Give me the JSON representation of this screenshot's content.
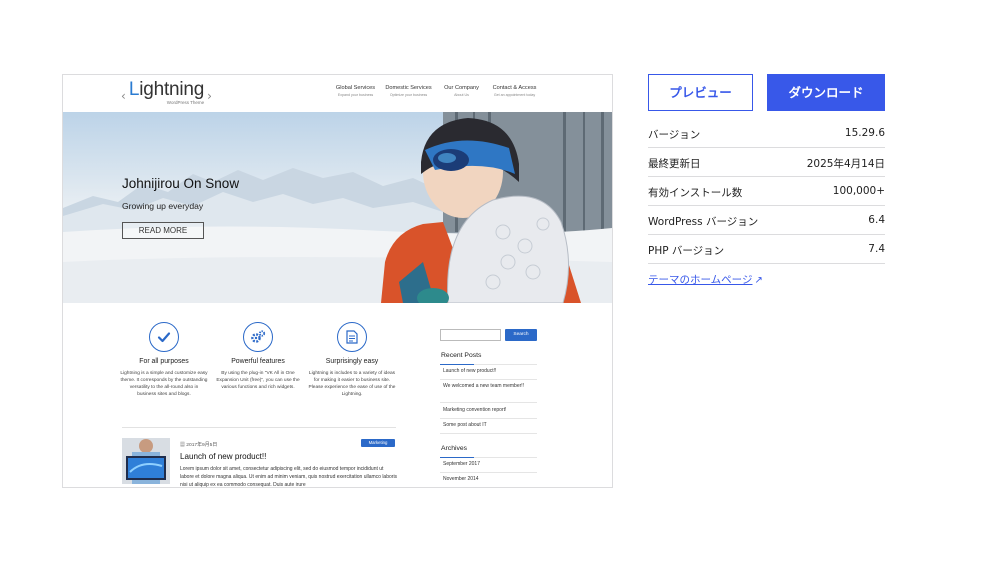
{
  "theme_preview": {
    "logo": {
      "prefix": "L",
      "text": "ightning",
      "sub": "WordPress Theme",
      "left_bracket": "‹",
      "right_bracket": "›"
    },
    "nav": [
      {
        "title": "Global Services",
        "sub": "Expand your business"
      },
      {
        "title": "Domestic Services",
        "sub": "Optimize your business"
      },
      {
        "title": "Our Company",
        "sub": "About Us"
      },
      {
        "title": "Contact & Access",
        "sub": "Get an appointment today"
      }
    ],
    "hero": {
      "title": "Johnijirou On Snow",
      "subtitle": "Growing up everyday",
      "button": "READ MORE"
    },
    "features": [
      {
        "icon": "check-icon",
        "title": "For all purposes",
        "desc": "Lightning is a simple and customize easy theme. It corresponds by the outstanding versatility to the all-round also in business sites and blogs."
      },
      {
        "icon": "gears-icon",
        "title": "Powerful features",
        "desc": "By using the plug-in \"VK All in One Expansion Unit (free)\", you can use the various functions and rich widgets."
      },
      {
        "icon": "document-icon",
        "title": "Surprisingly easy",
        "desc": "Lightning is includes to a variety of ideas for making it easier to business site. Please experience the ease of use of the Lightning."
      }
    ],
    "post": {
      "date": "2017年9月5日",
      "category": "Marketing",
      "title": "Launch of new product!!",
      "excerpt": "Lorem ipsum dolor sit amet, consectetur adipiscing elit, sed do eiusmod tempor incididunt ut labore et dolore magna aliqua. Ut enim ad minim veniam, quis nostrud exercitation ullamco laboris nisi ut aliquip ex ea commodo consequat. Duis aute irure"
    },
    "sidebar": {
      "search_button": "Search",
      "recent_posts_title": "Recent Posts",
      "recent_posts": [
        "Launch of new product!!",
        "We welcomed a new team member!!",
        "Marketing convention report!",
        "Some post about IT"
      ],
      "archives_title": "Archives",
      "archives": [
        "September 2017",
        "November 2014"
      ]
    }
  },
  "actions": {
    "preview": "プレビュー",
    "download": "ダウンロード"
  },
  "meta": [
    {
      "label": "バージョン",
      "value": "15.29.6"
    },
    {
      "label": "最終更新日",
      "value": "2025年4月14日"
    },
    {
      "label": "有効インストール数",
      "value": "100,000+"
    },
    {
      "label": "WordPress バージョン",
      "value": "6.4"
    },
    {
      "label": "PHP バージョン",
      "value": "7.4"
    }
  ],
  "homepage_link": {
    "text": "テーマのホームページ",
    "icon": "external-arrow-icon"
  },
  "colors": {
    "accent": "#3858e9",
    "theme_blue": "#2b69c8",
    "divider": "#dcdcde"
  }
}
